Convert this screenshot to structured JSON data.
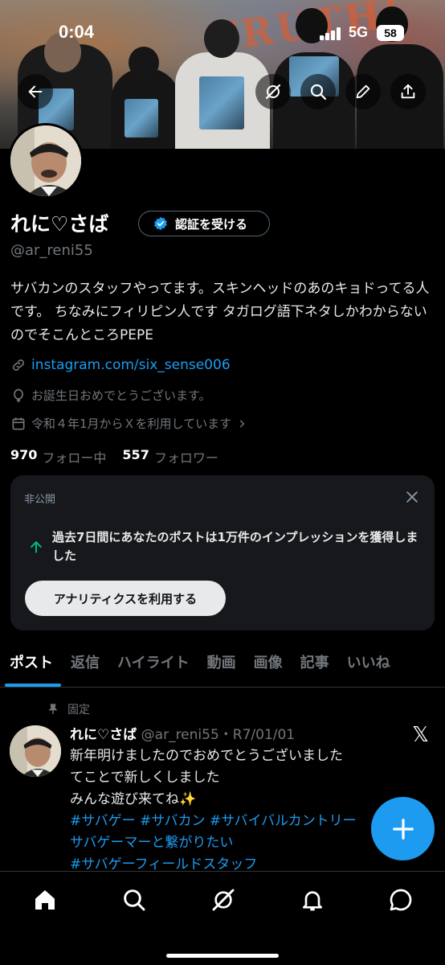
{
  "status_bar": {
    "time": "0:04",
    "network": "5G",
    "battery": "58"
  },
  "profile": {
    "name": "れに♡さば",
    "verify_label": "認証を受ける",
    "handle": "@ar_reni55",
    "bio": "サバカンのスタッフやってます。スキンヘッドのあのキョドってる人です。 ちなみにフィリピン人です タガログ語下ネタしかわからないのでそこんところPEPE",
    "link": "instagram.com/six_sense006",
    "birthday": "お誕生日おめでとうございます。",
    "joined": "令和４年1月からＸを利用しています",
    "following_count": "970",
    "following_label": "フォロー中",
    "followers_count": "557",
    "followers_label": "フォロワー"
  },
  "analytics_card": {
    "label": "非公開",
    "message": "過去7日間にあなたのポストは1万件のインプレッションを獲得しました",
    "button": "アナリティクスを利用する"
  },
  "tabs": [
    "ポスト",
    "返信",
    "ハイライト",
    "動画",
    "画像",
    "記事",
    "いいね"
  ],
  "active_tab": "ポスト",
  "pinned_post": {
    "pinned_label": "固定",
    "name": "れに♡さば",
    "handle_date": "@ar_reni55・R7/01/01",
    "text_line1": "新年明けましたのでおめでとうございました",
    "text_line2": "てことで新しくしました",
    "text_line3": "みんな遊び来てね✨",
    "hashtags_line1": " #サバゲー #サバカン #サバイバルカントリー",
    "hashtags_line2": "サバゲーマーと繋がりたい",
    "hashtags_line3": " #サバゲーフィールドスタッフ"
  },
  "banner_graffiti": "TRUTH!",
  "icons": [
    "back-arrow-icon",
    "grok-icon",
    "search-icon",
    "edit-icon",
    "share-icon",
    "link-icon",
    "balloon-icon",
    "calendar-icon",
    "close-icon",
    "up-arrow-icon",
    "pin-icon",
    "x-logo-icon",
    "plus-icon",
    "home-icon",
    "search-icon",
    "grok-icon",
    "bell-icon",
    "messages-icon"
  ],
  "colors": {
    "accent": "#1d9bf0",
    "background": "#000000",
    "muted": "#71767b",
    "card": "#16181c",
    "up_arrow": "#00ba7c"
  }
}
